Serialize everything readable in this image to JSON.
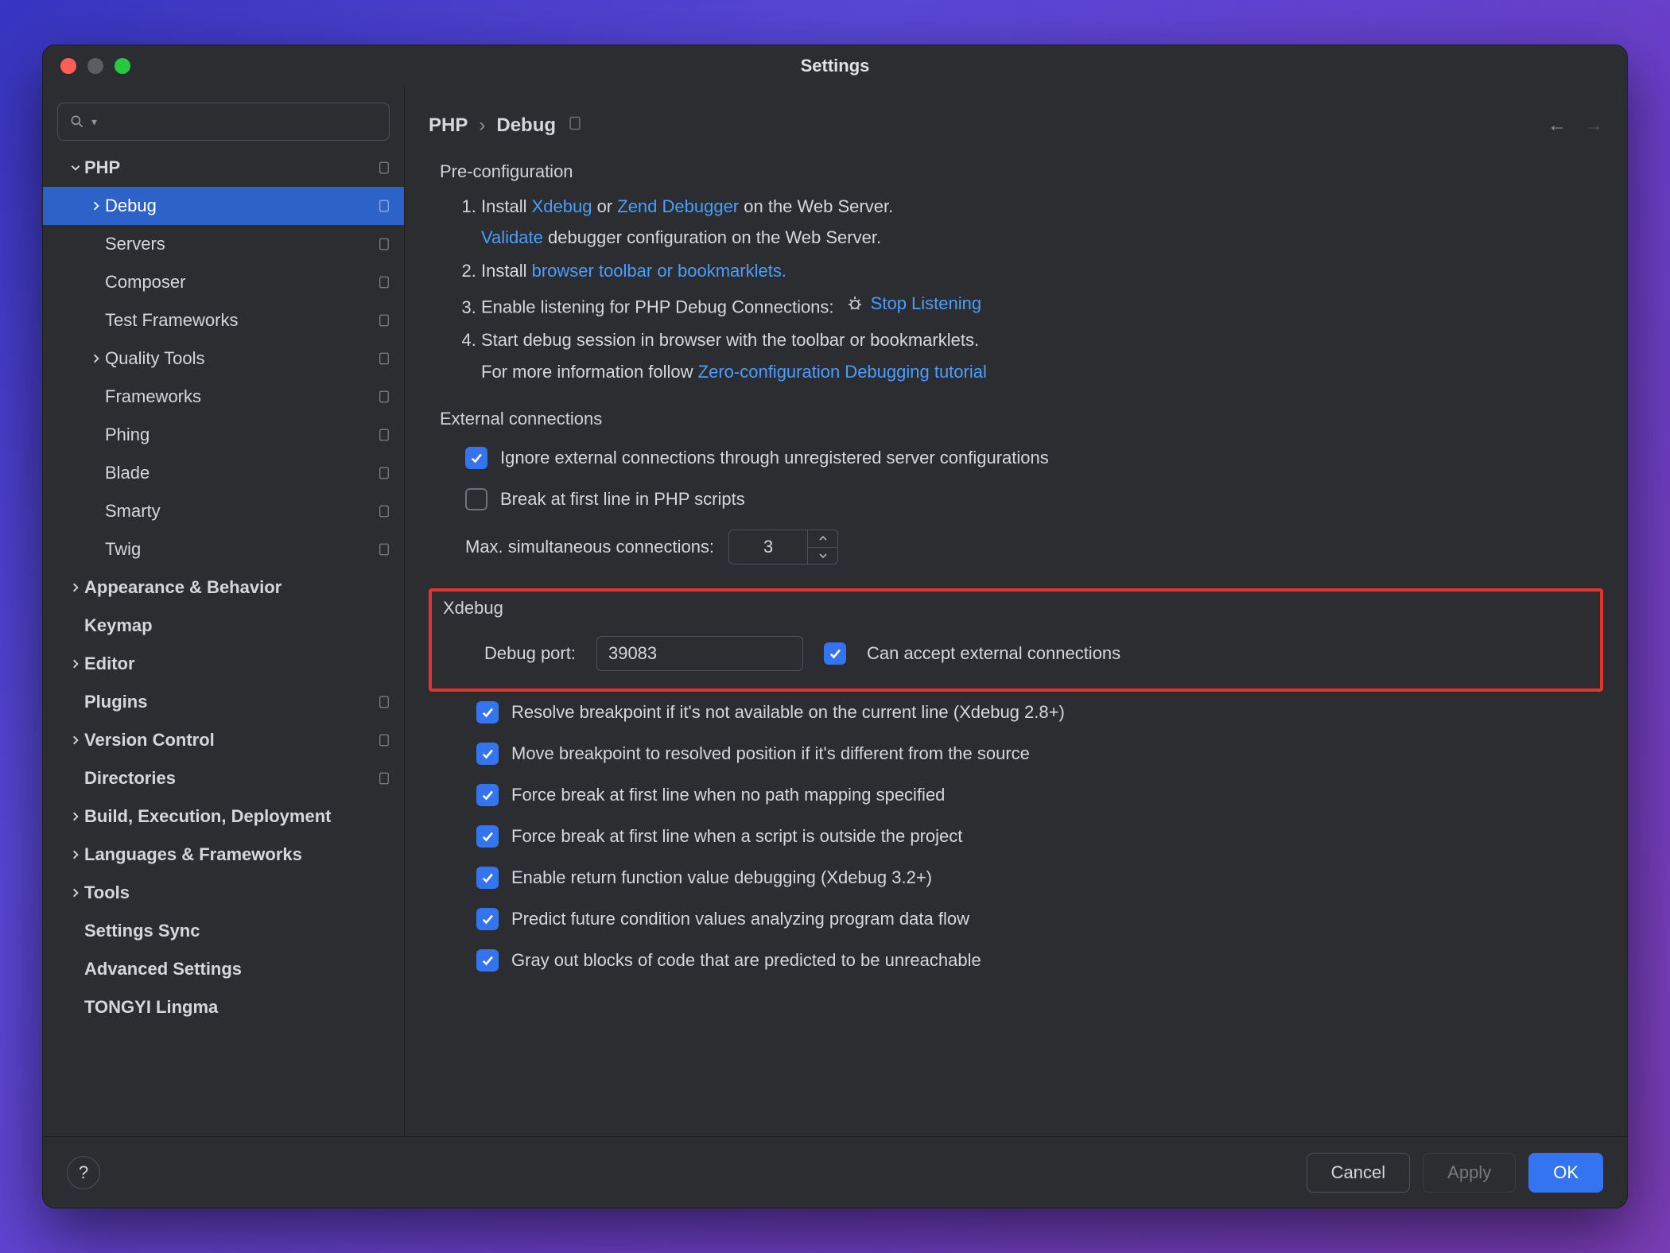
{
  "window_title": "Settings",
  "search_placeholder": "",
  "sidebar": {
    "items": [
      {
        "label": "PHP",
        "indent": 0,
        "bold": true,
        "chev": "down",
        "right_icon": true,
        "selected": false
      },
      {
        "label": "Debug",
        "indent": 1,
        "bold": false,
        "chev": "right",
        "right_icon": true,
        "selected": true
      },
      {
        "label": "Servers",
        "indent": 1,
        "bold": false,
        "chev": "",
        "right_icon": true,
        "selected": false
      },
      {
        "label": "Composer",
        "indent": 1,
        "bold": false,
        "chev": "",
        "right_icon": true,
        "selected": false
      },
      {
        "label": "Test Frameworks",
        "indent": 1,
        "bold": false,
        "chev": "",
        "right_icon": true,
        "selected": false
      },
      {
        "label": "Quality Tools",
        "indent": 1,
        "bold": false,
        "chev": "right",
        "right_icon": true,
        "selected": false
      },
      {
        "label": "Frameworks",
        "indent": 1,
        "bold": false,
        "chev": "",
        "right_icon": true,
        "selected": false
      },
      {
        "label": "Phing",
        "indent": 1,
        "bold": false,
        "chev": "",
        "right_icon": true,
        "selected": false
      },
      {
        "label": "Blade",
        "indent": 1,
        "bold": false,
        "chev": "",
        "right_icon": true,
        "selected": false
      },
      {
        "label": "Smarty",
        "indent": 1,
        "bold": false,
        "chev": "",
        "right_icon": true,
        "selected": false
      },
      {
        "label": "Twig",
        "indent": 1,
        "bold": false,
        "chev": "",
        "right_icon": true,
        "selected": false
      },
      {
        "label": "Appearance & Behavior",
        "indent": 0,
        "bold": true,
        "chev": "right",
        "right_icon": false,
        "selected": false
      },
      {
        "label": "Keymap",
        "indent": 0,
        "bold": true,
        "chev": "",
        "right_icon": false,
        "selected": false
      },
      {
        "label": "Editor",
        "indent": 0,
        "bold": true,
        "chev": "right",
        "right_icon": false,
        "selected": false
      },
      {
        "label": "Plugins",
        "indent": 0,
        "bold": true,
        "chev": "",
        "right_icon": true,
        "selected": false
      },
      {
        "label": "Version Control",
        "indent": 0,
        "bold": true,
        "chev": "right",
        "right_icon": true,
        "selected": false
      },
      {
        "label": "Directories",
        "indent": 0,
        "bold": true,
        "chev": "",
        "right_icon": true,
        "selected": false
      },
      {
        "label": "Build, Execution, Deployment",
        "indent": 0,
        "bold": true,
        "chev": "right",
        "right_icon": false,
        "selected": false
      },
      {
        "label": "Languages & Frameworks",
        "indent": 0,
        "bold": true,
        "chev": "right",
        "right_icon": false,
        "selected": false
      },
      {
        "label": "Tools",
        "indent": 0,
        "bold": true,
        "chev": "right",
        "right_icon": false,
        "selected": false
      },
      {
        "label": "Settings Sync",
        "indent": 0,
        "bold": true,
        "chev": "",
        "right_icon": false,
        "selected": false
      },
      {
        "label": "Advanced Settings",
        "indent": 0,
        "bold": true,
        "chev": "",
        "right_icon": false,
        "selected": false
      },
      {
        "label": "TONGYI Lingma",
        "indent": 0,
        "bold": true,
        "chev": "",
        "right_icon": false,
        "selected": false
      }
    ]
  },
  "breadcrumb": {
    "root": "PHP",
    "leaf": "Debug"
  },
  "preconfig": {
    "title": "Pre-configuration",
    "step1_a": "Install ",
    "step1_link1": "Xdebug",
    "step1_b": " or ",
    "step1_link2": "Zend Debugger",
    "step1_c": " on the Web Server.",
    "step1_sub_link": "Validate",
    "step1_sub_rest": " debugger configuration on the Web Server.",
    "step2_a": "Install ",
    "step2_link": "browser toolbar or bookmarklets.",
    "step3_a": "Enable listening for PHP Debug Connections:",
    "step3_link": "Stop Listening",
    "step4_a": "Start debug session in browser with the toolbar or bookmarklets.",
    "step4_sub_a": "For more information follow ",
    "step4_sub_link": "Zero-configuration Debugging tutorial"
  },
  "external": {
    "title": "External connections",
    "cb_ignore": "Ignore external connections through unregistered server configurations",
    "cb_break": "Break at first line in PHP scripts",
    "max_label": "Max. simultaneous connections:",
    "max_value": "3"
  },
  "xdebug": {
    "title": "Xdebug",
    "port_label": "Debug port:",
    "port_value": "39083",
    "cb_accept": "Can accept external connections",
    "cb_resolve": "Resolve breakpoint if it's not available on the current line (Xdebug 2.8+)",
    "cb_move": "Move breakpoint to resolved position if it's different from the source",
    "cb_force_nomap": "Force break at first line when no path mapping specified",
    "cb_force_outside": "Force break at first line when a script is outside the project",
    "cb_return": "Enable return function value debugging (Xdebug 3.2+)",
    "cb_predict": "Predict future condition values analyzing program data flow",
    "cb_gray": "Gray out blocks of code that are predicted to be unreachable"
  },
  "footer": {
    "help": "?",
    "cancel": "Cancel",
    "apply": "Apply",
    "ok": "OK"
  }
}
